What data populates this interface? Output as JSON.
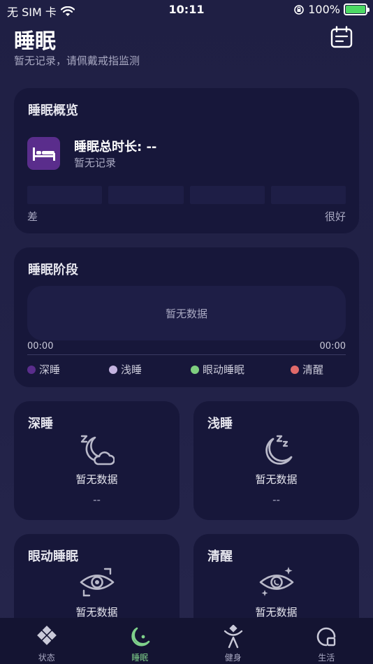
{
  "status_bar": {
    "carrier": "无 SIM 卡",
    "time": "10:11",
    "battery": "100%"
  },
  "header": {
    "title": "睡眠",
    "subtitle": "暂无记录，请佩戴戒指监测",
    "calendar_icon": "calendar-icon"
  },
  "overview": {
    "title": "睡眠概览",
    "duration_label": "睡眠总时长: --",
    "status": "暂无记录",
    "scale_low": "差",
    "scale_high": "很好"
  },
  "stages": {
    "title": "睡眠阶段",
    "empty": "暂无数据",
    "time_start": "00:00",
    "time_end": "00:00",
    "legend": [
      {
        "label": "深睡",
        "color": "#5a2d8c"
      },
      {
        "label": "浅睡",
        "color": "#c4b3e0"
      },
      {
        "label": "眼动睡眠",
        "color": "#7fcf7f"
      },
      {
        "label": "清醒",
        "color": "#e06a6a"
      }
    ]
  },
  "cards": {
    "deep": {
      "title": "深睡",
      "nodata": "暂无数据",
      "value": "--"
    },
    "light": {
      "title": "浅睡",
      "nodata": "暂无数据",
      "value": "--"
    },
    "rem": {
      "title": "眼动睡眠",
      "nodata": "暂无数据"
    },
    "awake": {
      "title": "清醒",
      "nodata": "暂无数据"
    }
  },
  "tabs": [
    {
      "label": "状态",
      "icon": "status-icon",
      "active": false
    },
    {
      "label": "睡眠",
      "icon": "sleep-moon-icon",
      "active": true
    },
    {
      "label": "健身",
      "icon": "fitness-icon",
      "active": false
    },
    {
      "label": "生活",
      "icon": "life-icon",
      "active": false
    }
  ],
  "colors": {
    "background": "#1f1f44",
    "card": "#17173a",
    "accent_green": "#7fd18b",
    "bed_tile": "#5a2d8c"
  }
}
